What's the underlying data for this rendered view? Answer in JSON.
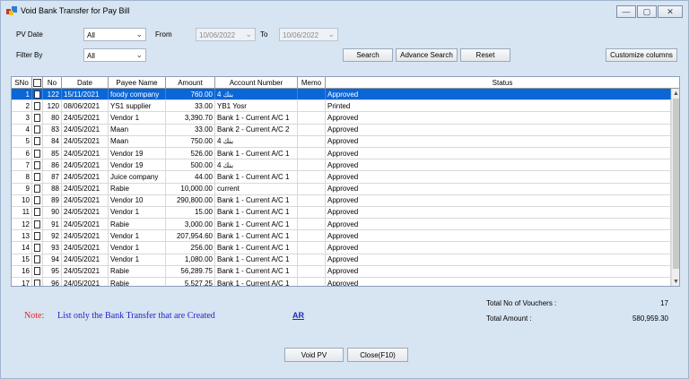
{
  "window": {
    "title": "Void Bank Transfer for Pay Bill",
    "min_glyph": "—",
    "max_glyph": "▢",
    "close_glyph": "✕",
    "icon": "app-icon"
  },
  "filters": {
    "pv_date_label": "PV Date",
    "pv_date_value": "All",
    "from_label": "From",
    "from_value": "10/06/2022",
    "to_label": "To",
    "to_value": "10/06/2022",
    "filter_by_label": "Filter By",
    "filter_by_value": "All"
  },
  "buttons": {
    "search": "Search",
    "advance_search": "Advance Search",
    "reset": "Reset",
    "customize_columns": "Customize columns",
    "void_pv": "Void PV",
    "close": "Close(F10)"
  },
  "grid": {
    "columns": [
      "SNo",
      "",
      "No",
      "Date",
      "Payee Name",
      "Amount",
      "Account Number",
      "Memo",
      "Status"
    ],
    "rows": [
      {
        "sno": "1",
        "no": "122",
        "date": "15/11/2021",
        "payee": "foody company",
        "amount": "760.00",
        "account": "بنك 4",
        "memo": "",
        "status": "Approved",
        "selected": true
      },
      {
        "sno": "2",
        "no": "120",
        "date": "08/06/2021",
        "payee": "YS1 supplier",
        "amount": "33.00",
        "account": "YB1 Yosr",
        "memo": "",
        "status": "Printed"
      },
      {
        "sno": "3",
        "no": "80",
        "date": "24/05/2021",
        "payee": "Vendor 1",
        "amount": "3,390.70",
        "account": "Bank 1 - Current A/C 1",
        "memo": "",
        "status": "Approved"
      },
      {
        "sno": "4",
        "no": "83",
        "date": "24/05/2021",
        "payee": "Maan",
        "amount": "33.00",
        "account": "Bank 2 - Current A/C 2",
        "memo": "",
        "status": "Approved"
      },
      {
        "sno": "5",
        "no": "84",
        "date": "24/05/2021",
        "payee": "Maan",
        "amount": "750.00",
        "account": "بنك 4",
        "memo": "",
        "status": "Approved"
      },
      {
        "sno": "6",
        "no": "85",
        "date": "24/05/2021",
        "payee": "Vendor 19",
        "amount": "526.00",
        "account": "Bank 1 - Current A/C 1",
        "memo": "",
        "status": "Approved"
      },
      {
        "sno": "7",
        "no": "86",
        "date": "24/05/2021",
        "payee": "Vendor 19",
        "amount": "500.00",
        "account": "بنك 4",
        "memo": "",
        "status": "Approved"
      },
      {
        "sno": "8",
        "no": "87",
        "date": "24/05/2021",
        "payee": "Juice company",
        "amount": "44.00",
        "account": "Bank 1 - Current A/C 1",
        "memo": "",
        "status": "Approved"
      },
      {
        "sno": "9",
        "no": "88",
        "date": "24/05/2021",
        "payee": "Rabie",
        "amount": "10,000.00",
        "account": "current",
        "memo": "",
        "status": "Approved"
      },
      {
        "sno": "10",
        "no": "89",
        "date": "24/05/2021",
        "payee": "Vendor 10",
        "amount": "290,800.00",
        "account": "Bank 1 - Current A/C 1",
        "memo": "",
        "status": "Approved"
      },
      {
        "sno": "11",
        "no": "90",
        "date": "24/05/2021",
        "payee": "Vendor 1",
        "amount": "15.00",
        "account": "Bank 1 - Current A/C 1",
        "memo": "",
        "status": "Approved"
      },
      {
        "sno": "12",
        "no": "91",
        "date": "24/05/2021",
        "payee": "Rabie",
        "amount": "3,000.00",
        "account": "Bank 1 - Current A/C 1",
        "memo": "",
        "status": "Approved"
      },
      {
        "sno": "13",
        "no": "92",
        "date": "24/05/2021",
        "payee": "Vendor 1",
        "amount": "207,954.60",
        "account": "Bank 1 - Current A/C 1",
        "memo": "",
        "status": "Approved"
      },
      {
        "sno": "14",
        "no": "93",
        "date": "24/05/2021",
        "payee": "Vendor 1",
        "amount": "256.00",
        "account": "Bank 1 - Current A/C 1",
        "memo": "",
        "status": "Approved"
      },
      {
        "sno": "15",
        "no": "94",
        "date": "24/05/2021",
        "payee": "Vendor 1",
        "amount": "1,080.00",
        "account": "Bank 1 - Current A/C 1",
        "memo": "",
        "status": "Approved"
      },
      {
        "sno": "16",
        "no": "95",
        "date": "24/05/2021",
        "payee": "Rabie",
        "amount": "56,289.75",
        "account": "Bank 1 - Current A/C 1",
        "memo": "",
        "status": "Approved"
      },
      {
        "sno": "17",
        "no": "96",
        "date": "24/05/2021",
        "payee": "Rabie",
        "amount": "5,527.25",
        "account": "Bank 1 - Current A/C 1",
        "memo": "",
        "status": "Approved"
      }
    ]
  },
  "summary": {
    "total_vouchers_label": "Total No of Vouchers :",
    "total_vouchers_value": "17",
    "total_amount_label": "Total Amount :",
    "total_amount_value": "580,959.30"
  },
  "note": {
    "label": "Note:",
    "text": "List only the Bank Transfer that are Created",
    "link": "AR"
  },
  "colors": {
    "selection": "#0b66d6",
    "note_label": "#e52222",
    "note_text": "#2424c8",
    "window_bg": "#d7e4f2"
  }
}
